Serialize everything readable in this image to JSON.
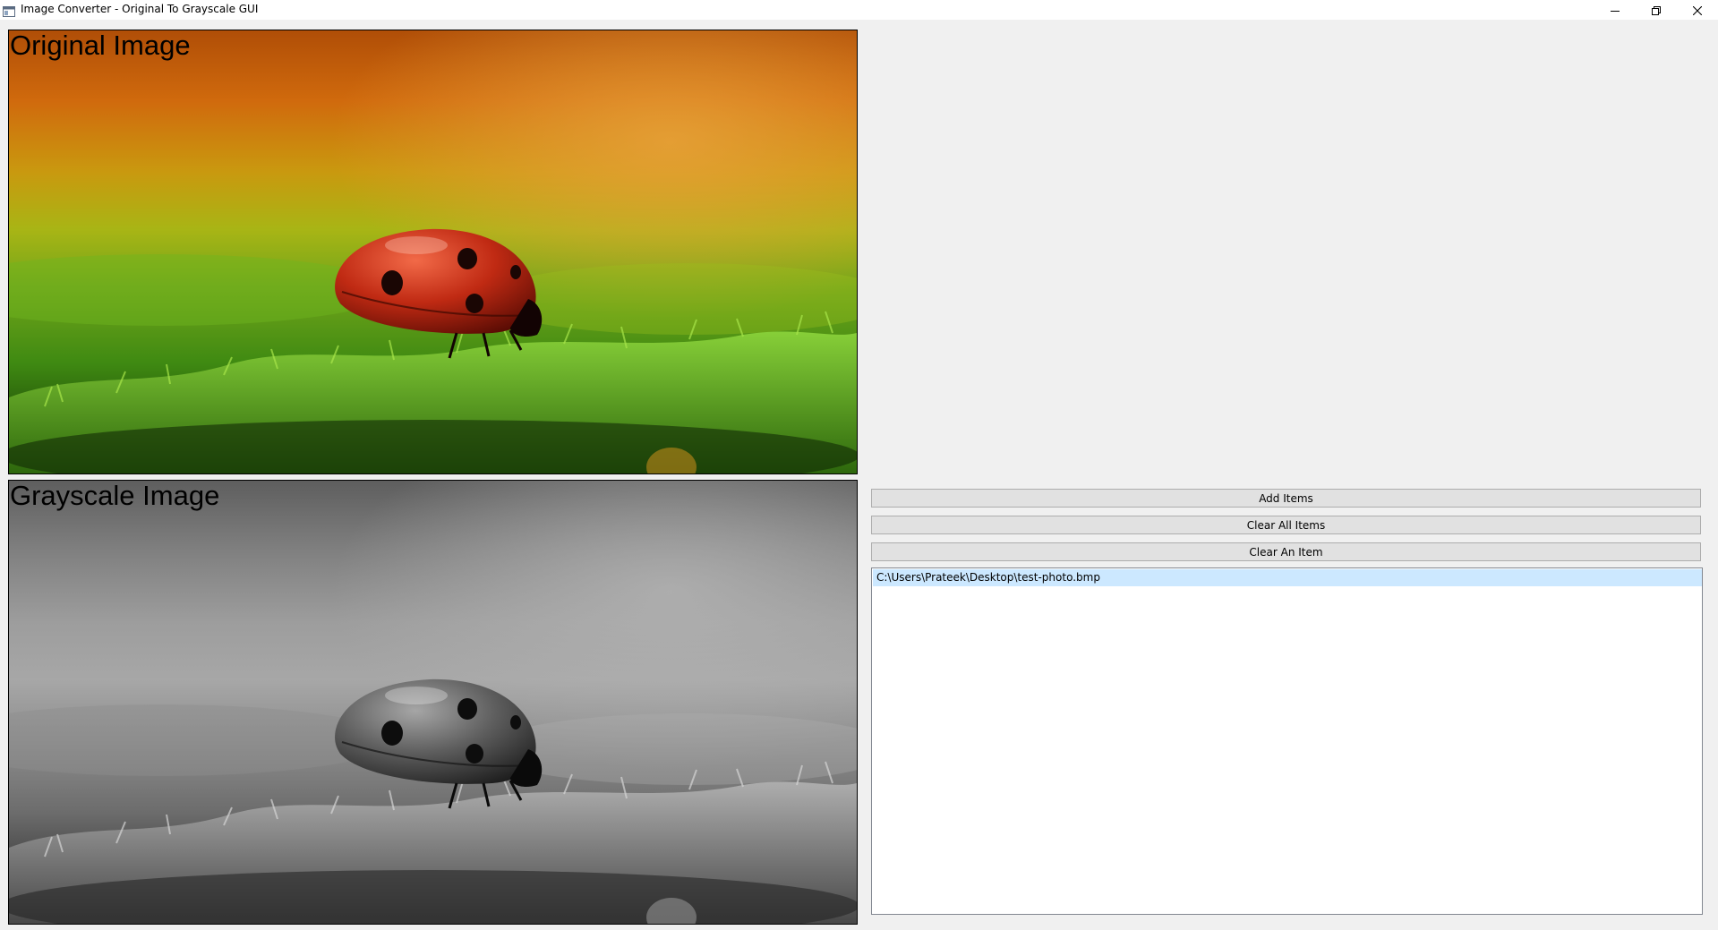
{
  "window": {
    "title": "Image Converter - Original To Grayscale GUI"
  },
  "panels": {
    "original_label": "Original Image",
    "grayscale_label": "Grayscale Image"
  },
  "controls": {
    "add_items": "Add Items",
    "clear_all_items": "Clear All Items",
    "clear_an_item": "Clear An Item"
  },
  "listbox": {
    "items": [
      "C:\\Users\\Prateek\\Desktop\\test-photo.bmp"
    ],
    "selected_index": 0
  },
  "icons": {
    "app": "app-window-icon",
    "minimize": "minimize-icon",
    "restore": "restore-icon",
    "close": "close-icon"
  },
  "colors": {
    "selection": "#cce8ff",
    "button_face": "#e1e1e1",
    "window_bg": "#f0f0f0"
  }
}
